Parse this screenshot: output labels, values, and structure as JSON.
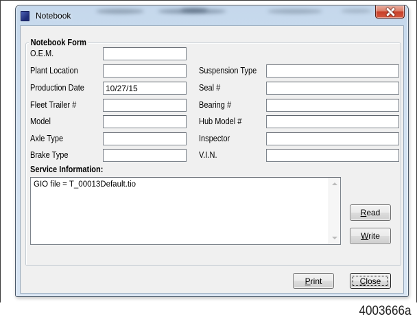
{
  "window": {
    "title": "Notebook",
    "app_icon": "notebook-app-icon",
    "close_icon": "close-icon"
  },
  "notebook_form": {
    "label": "Notebook Form",
    "left_fields": [
      {
        "label": "O.E.M.",
        "value": ""
      },
      {
        "label": "Plant Location",
        "value": ""
      },
      {
        "label": "Production Date",
        "value": "10/27/15"
      },
      {
        "label": "Fleet Trailer #",
        "value": ""
      },
      {
        "label": "Model",
        "value": ""
      },
      {
        "label": "Axle Type",
        "value": ""
      },
      {
        "label": "Brake Type",
        "value": ""
      }
    ],
    "right_fields": [
      {
        "label": "Suspension Type",
        "value": ""
      },
      {
        "label": "Seal #",
        "value": ""
      },
      {
        "label": "Bearing #",
        "value": ""
      },
      {
        "label": "Hub Model #",
        "value": ""
      },
      {
        "label": "Inspector",
        "value": ""
      },
      {
        "label": "V.I.N.",
        "value": ""
      }
    ]
  },
  "service_information": {
    "label": "Service Information:",
    "text": "GIO file = T_00013Default.tio",
    "scroll_up_icon": "scroll-up-arrow-icon",
    "scroll_down_icon": "scroll-down-arrow-icon"
  },
  "buttons": {
    "read": "Read",
    "write": "Write",
    "print": "Print",
    "close": "Close"
  },
  "figure_id": "4003666a",
  "colors": {
    "window_frame": "#c5d8ec",
    "client_background": "#f0f0f0",
    "close_button": "#c7402a",
    "app_icon": "#1f2d78"
  }
}
